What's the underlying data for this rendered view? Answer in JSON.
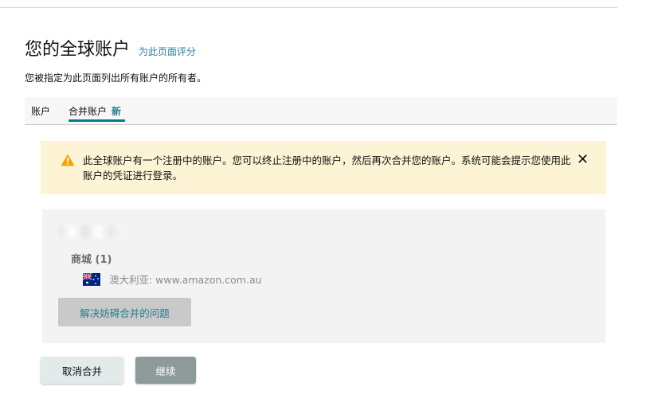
{
  "header": {
    "title": "您的全球账户",
    "rate_link": "为此页面评分",
    "subtitle": "您被指定为此页面列出所有账户的所有者。"
  },
  "tabs": [
    {
      "label": "账户",
      "active": false
    },
    {
      "label": "合并账户",
      "badge": "新",
      "active": true
    }
  ],
  "alert": {
    "icon": "warning-icon",
    "text": "此全球账户有一个注册中的账户。您可以终止注册中的账户，然后再次合并您的账户。系统可能会提示您使用此账户的凭证进行登录。",
    "close_icon": "close-icon"
  },
  "account_panel": {
    "store_heading": "商城 (1)",
    "marketplace": {
      "flag_icon": "australia-flag-icon",
      "label": "澳大利亚: www.amazon.com.au"
    },
    "resolve_button": "解决妨碍合并的问题"
  },
  "actions": {
    "cancel_label": "取消合并",
    "continue_label": "继续"
  },
  "colors": {
    "accent_teal": "#007d8a",
    "link": "#2a7fa0",
    "alert_bg": "#fcf4d4",
    "panel_bg": "#f3f3f3",
    "continue_bg": "#8c9a9a",
    "warning": "#f0a800"
  }
}
